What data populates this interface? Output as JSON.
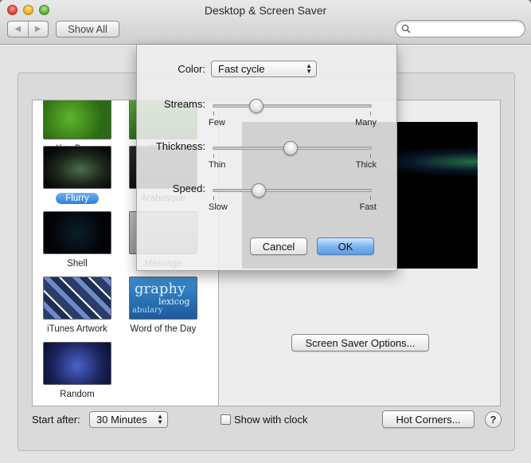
{
  "window": {
    "title": "Desktop & Screen Saver"
  },
  "toolbar": {
    "show_all_label": "Show All",
    "back_glyph": "◀",
    "forward_glyph": "▶",
    "search_placeholder": ""
  },
  "screensavers": [
    {
      "name": "Ken Burns",
      "style": "t-ken",
      "selected": false
    },
    {
      "name": "Classic",
      "style": "t-green2",
      "selected": false
    },
    {
      "name": "Flurry",
      "style": "t-flurry",
      "selected": true
    },
    {
      "name": "Arabesque",
      "style": "t-dark",
      "selected": false
    },
    {
      "name": "Shell",
      "style": "t-shell",
      "selected": false
    },
    {
      "name": "Message",
      "style": "t-grey",
      "selected": false
    },
    {
      "name": "iTunes Artwork",
      "style": "t-itunes",
      "selected": false
    },
    {
      "name": "Word of the Day",
      "style": "t-word",
      "selected": false
    },
    {
      "name": "Random",
      "style": "t-random",
      "selected": false
    }
  ],
  "word_thumb_text": {
    "big": "graphy",
    "line2": "lexicog",
    "line3": "abulary"
  },
  "preview": {
    "options_button": "Screen Saver Options..."
  },
  "bottom": {
    "start_after_label": "Start after:",
    "start_after_value": "30 Minutes",
    "show_clock_label": "Show with clock",
    "show_clock_checked": false,
    "hot_corners_label": "Hot Corners...",
    "help_label": "?"
  },
  "sheet": {
    "color_label": "Color:",
    "color_value": "Fast cycle",
    "streams": {
      "label": "Streams:",
      "min": "Few",
      "max": "Many",
      "value": 0.25
    },
    "thickness": {
      "label": "Thickness:",
      "min": "Thin",
      "max": "Thick",
      "value": 0.49
    },
    "speed": {
      "label": "Speed:",
      "min": "Slow",
      "max": "Fast",
      "value": 0.27
    },
    "cancel_label": "Cancel",
    "ok_label": "OK"
  }
}
